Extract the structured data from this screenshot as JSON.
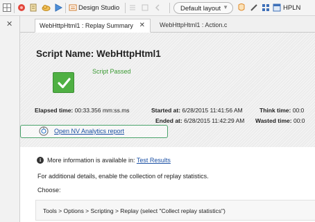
{
  "toolbar": {
    "design_studio_label": "Design Studio",
    "layout_label": "Default layout",
    "hpln_label": "HPLN",
    "icons": [
      "grid-icon",
      "record-icon",
      "script-icon",
      "cloud-icon",
      "play-icon",
      "design-studio-icon",
      "list-icon",
      "back-icon",
      "help-icon",
      "bug-icon",
      "pen-icon",
      "tiles-icon",
      "window-icon"
    ]
  },
  "tabs": [
    {
      "label": "WebHttpHtml1 : Replay Summary",
      "active": true
    },
    {
      "label": "WebHttpHtml1 : Action.c",
      "active": false
    }
  ],
  "summary": {
    "script_name": "Script Name: WebHttpHtml1",
    "status": "Script Passed",
    "elapsed_label": "Elapsed time:",
    "elapsed_value": "00:33.356 mm:ss.ms",
    "started_label": "Started at:",
    "started_value": "6/28/2015 11:41:56 AM",
    "ended_label": "Ended at:",
    "ended_value": "6/28/2015 11:42:29 AM",
    "think_label": "Think time:",
    "think_value": "00:0",
    "wasted_label": "Wasted time:",
    "wasted_value": "00:0"
  },
  "nv_link": "Open NV Analytics report",
  "info": {
    "text": "More information is available in:",
    "link": "Test Results"
  },
  "details_text": "For additional details, enable the collection of replay statistics.",
  "choose_text": "Choose:",
  "instruction": "Tools > Options > Scripting > Replay (select \"Collect replay statistics\")",
  "colors": {
    "pass_green": "#4fb043",
    "link_blue": "#1a4fa3",
    "highlight_box": "#4aa36b"
  }
}
